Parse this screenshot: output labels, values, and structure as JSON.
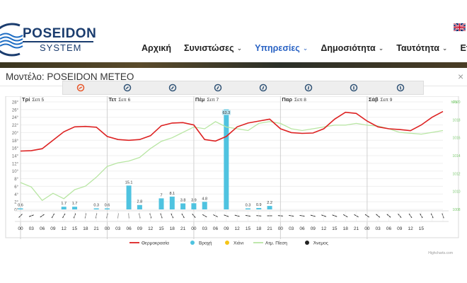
{
  "header": {
    "logo_title": "POSEIDON",
    "logo_subtitle": "SYSTEM",
    "nav": [
      {
        "label": "Αρχική",
        "caret": false,
        "active": false
      },
      {
        "label": "Συνιστώσες",
        "caret": true,
        "active": false
      },
      {
        "label": "Υπηρεσίες",
        "caret": true,
        "active": true
      },
      {
        "label": "Δημοσιότητα",
        "caret": true,
        "active": false
      },
      {
        "label": "Ταυτότητα",
        "caret": true,
        "active": false
      },
      {
        "label": "Επικοινωνία",
        "caret": false,
        "active": false
      }
    ],
    "flag_icon": "uk-flag-icon"
  },
  "modal": {
    "title": "Μοντέλο: POSEIDON METEO",
    "close_symbol": "×"
  },
  "colors": {
    "temperature": "#dd2222",
    "rain": "#4fc3e0",
    "snow": "#f5c518",
    "pressure": "#b8e6a3",
    "wind": "#222222",
    "nav_active": "#2a63c4"
  },
  "chart_data": {
    "type": "line",
    "days": [
      {
        "name": "Τρί",
        "date": "Σεπ 5"
      },
      {
        "name": "Τετ",
        "date": "Σεπ 6"
      },
      {
        "name": "Πέμ",
        "date": "Σεπ 7"
      },
      {
        "name": "Παρ",
        "date": "Σεπ 8"
      },
      {
        "name": "Σάβ",
        "date": "Σεπ 9"
      }
    ],
    "x_labels": [
      "00",
      "03",
      "06",
      "09",
      "12",
      "15",
      "18",
      "21",
      "00",
      "03",
      "06",
      "09",
      "12",
      "15",
      "18",
      "21",
      "00",
      "03",
      "06",
      "09",
      "12",
      "15",
      "18",
      "21",
      "00",
      "03",
      "06",
      "09",
      "12",
      "15",
      "18",
      "21",
      "00",
      "03",
      "06",
      "09",
      "12",
      "15"
    ],
    "y_left_ticks": [
      "0°",
      "2°",
      "4°",
      "6°",
      "8°",
      "10°",
      "12°",
      "14°",
      "16°",
      "18°",
      "20°",
      "22°",
      "24°",
      "26°",
      "28°"
    ],
    "y_right_label": "hPa",
    "y_right_ticks": [
      "1020",
      "1018",
      "1016",
      "1014",
      "1012",
      "1010",
      "1008"
    ],
    "temp_ylim": [
      0,
      28
    ],
    "pressure_ylim": [
      1008,
      1020
    ],
    "series": [
      {
        "name": "Θερμοκρασία",
        "kind": "line",
        "values": [
          15.2,
          15.3,
          15.8,
          18.0,
          20.2,
          21.5,
          21.6,
          21.4,
          19.0,
          18.2,
          18.0,
          18.2,
          19.2,
          21.8,
          22.5,
          22.6,
          22.0,
          18.2,
          17.8,
          19.0,
          21.5,
          22.5,
          23.0,
          23.5,
          21.0,
          20.0,
          19.8,
          19.9,
          21.0,
          23.5,
          25.3,
          25.0,
          23.0,
          21.5,
          21.0,
          20.8,
          20.5,
          22.0,
          24.0,
          25.5
        ]
      },
      {
        "name": "Βροχή",
        "kind": "bar",
        "values": [
          0.6,
          0,
          0,
          0,
          1.7,
          1.7,
          0,
          0.3,
          0.6,
          0,
          15.1,
          2.8,
          0,
          7.0,
          8.1,
          3.8,
          3.9,
          4.8,
          0,
          63.3,
          0,
          0.3,
          0.9,
          2.2,
          0,
          0,
          0,
          0,
          0,
          0,
          0,
          0,
          0,
          0,
          0,
          0,
          0,
          0,
          0,
          0
        ]
      },
      {
        "name": "Χιόνι",
        "kind": "bar",
        "values": []
      },
      {
        "name": "Ατμ. Πίεση",
        "kind": "line",
        "values": [
          1011.0,
          1010.5,
          1009.0,
          1009.8,
          1009.2,
          1010.2,
          1010.6,
          1011.6,
          1012.8,
          1013.2,
          1013.4,
          1013.8,
          1014.8,
          1015.6,
          1016.0,
          1016.6,
          1017.2,
          1017.0,
          1017.8,
          1017.2,
          1017.0,
          1016.8,
          1017.6,
          1017.8,
          1017.6,
          1017.0,
          1016.8,
          1017.0,
          1017.2,
          1017.4,
          1017.4,
          1017.6,
          1017.4,
          1017.3,
          1017.0,
          1016.6,
          1016.5,
          1016.4,
          1016.6,
          1016.8
        ]
      },
      {
        "name": "Άνεμος",
        "kind": "arrow",
        "values": [
          -45,
          -20,
          -35,
          -60,
          -60,
          -70,
          -80,
          -80,
          -80,
          -85,
          -95,
          -100,
          -105,
          -110,
          -115,
          -120,
          -130,
          -150,
          -155,
          -160,
          -165,
          -170,
          -175,
          -180,
          -175,
          -170,
          -170,
          -165,
          -160,
          -160,
          -150,
          -150,
          -145,
          -140,
          -140,
          -130,
          -125,
          -120,
          -115,
          -110
        ]
      }
    ],
    "legend_position": "bottom-center",
    "credit": "Highcharts.com"
  }
}
